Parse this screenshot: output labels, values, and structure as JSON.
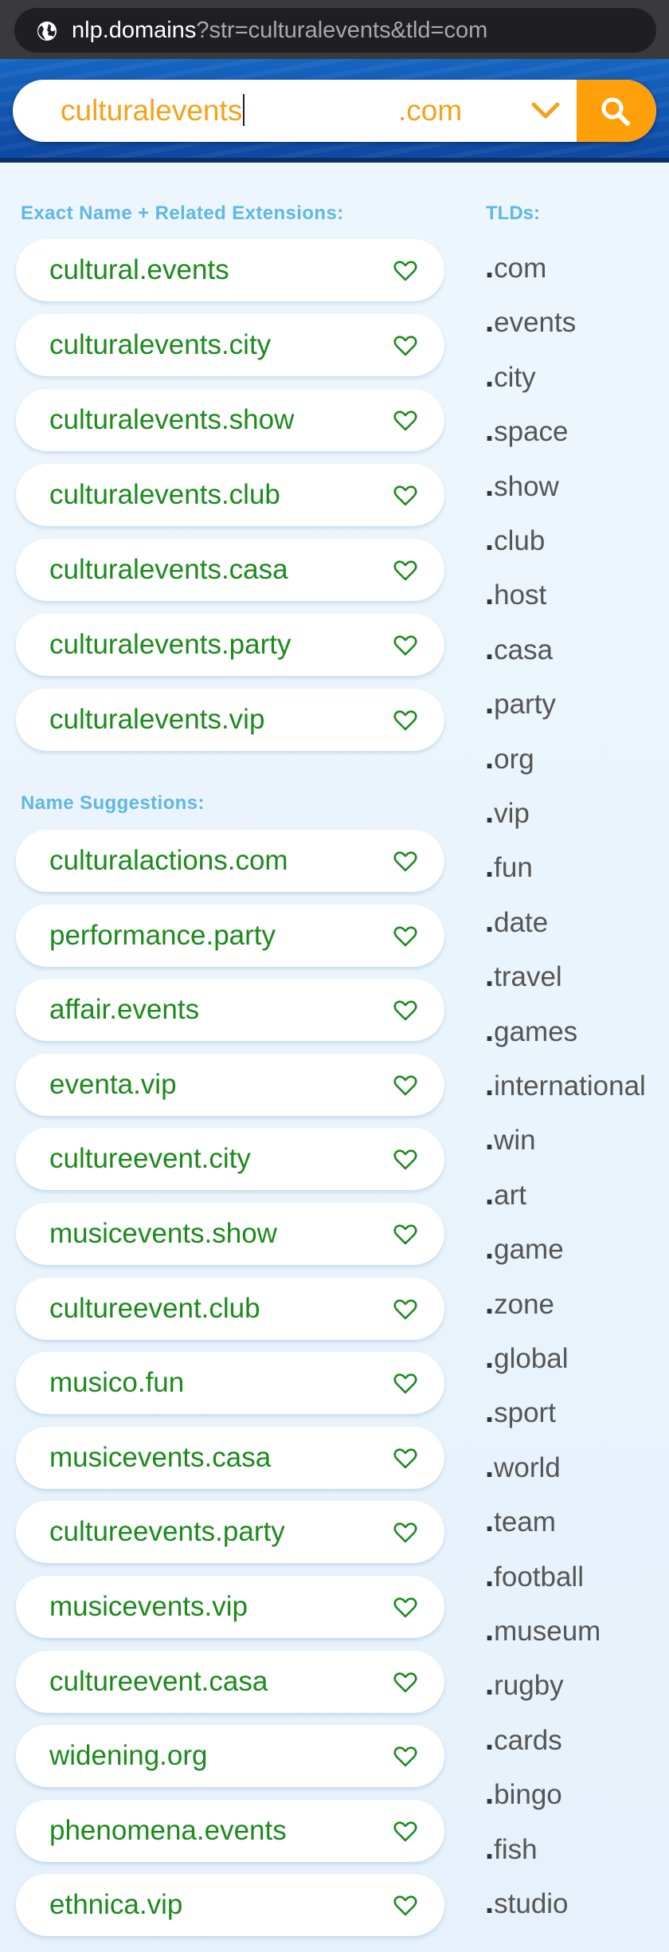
{
  "browser": {
    "url_host": "nlp.domains",
    "url_query": "?str=culturalevents&tld=com"
  },
  "search": {
    "query": "culturalevents",
    "tld": ".com"
  },
  "sections": {
    "exact_title": "Exact Name + Related Extensions:",
    "suggestions_title": "Name Suggestions:",
    "tlds_title": "TLDs:"
  },
  "exact_results": [
    "cultural.events",
    "culturalevents.city",
    "culturalevents.show",
    "culturalevents.club",
    "culturalevents.casa",
    "culturalevents.party",
    "culturalevents.vip"
  ],
  "suggestions": [
    "culturalactions.com",
    "performance.party",
    "affair.events",
    "eventa.vip",
    "cultureevent.city",
    "musicevents.show",
    "cultureevent.club",
    "musico.fun",
    "musicevents.casa",
    "cultureevents.party",
    "musicevents.vip",
    "cultureevent.casa",
    "widening.org",
    "phenomena.events",
    "ethnica.vip"
  ],
  "tlds": [
    "com",
    "events",
    "city",
    "space",
    "show",
    "club",
    "host",
    "casa",
    "party",
    "org",
    "vip",
    "fun",
    "date",
    "travel",
    "games",
    "international",
    "win",
    "art",
    "game",
    "zone",
    "global",
    "sport",
    "world",
    "team",
    "football",
    "museum",
    "rugby",
    "cards",
    "bingo",
    "fish",
    "studio"
  ],
  "colors": {
    "accent_orange": "#ff9f0a",
    "domain_green": "#1c8a1c",
    "section_blue": "#5fb8e3",
    "header_blue": "#1565c0"
  }
}
